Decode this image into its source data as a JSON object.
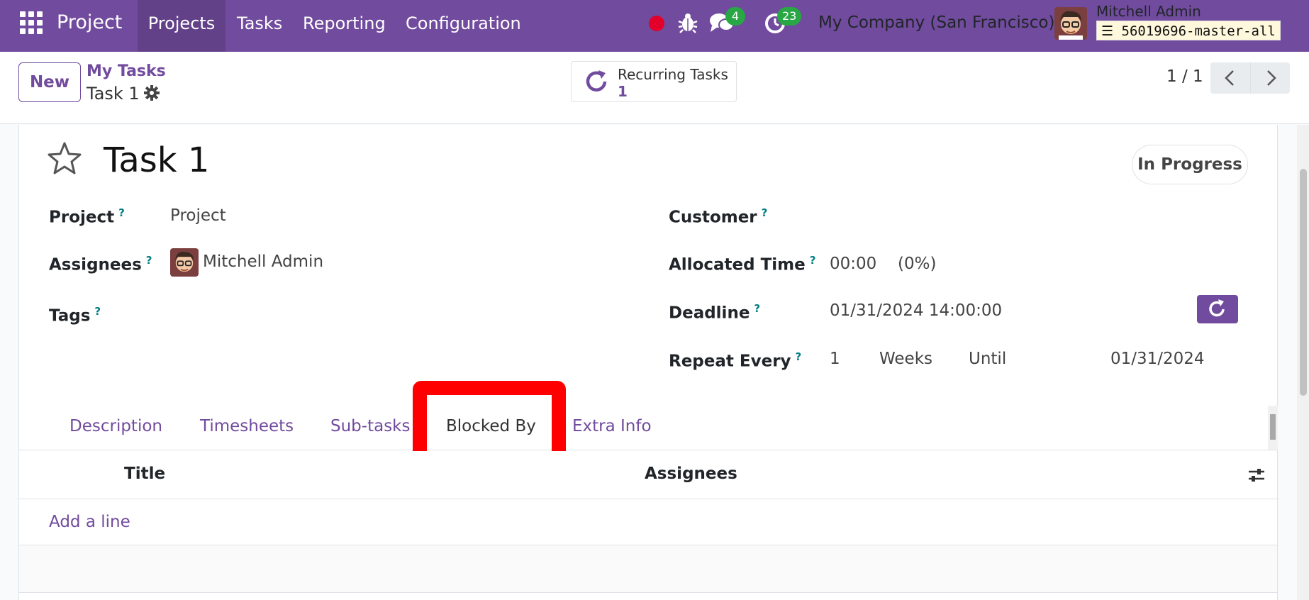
{
  "navbar": {
    "app_name": "Project",
    "menu": [
      "Projects",
      "Tasks",
      "Reporting",
      "Configuration"
    ],
    "chat_count": "4",
    "activity_count": "23",
    "company": "My Company (San Francisco)",
    "user": "Mitchell Admin",
    "database": "56019696-master-all"
  },
  "control_panel": {
    "new_label": "New",
    "breadcrumb_parent": "My Tasks",
    "breadcrumb_current": "Task 1",
    "recurring_label": "Recurring Tasks",
    "recurring_count": "1",
    "pager": "1 / 1"
  },
  "form": {
    "title": "Task 1",
    "stage": "In Progress",
    "help_mark": "?",
    "fields": {
      "project_label": "Project",
      "project_value": "Project",
      "assignees_label": "Assignees",
      "assignee_value": "Mitchell Admin",
      "tags_label": "Tags",
      "customer_label": "Customer",
      "allocated_label": "Allocated Time",
      "allocated_value": "00:00",
      "allocated_percent": "(0%)",
      "deadline_label": "Deadline",
      "deadline_value": "01/31/2024 14:00:00",
      "repeat_label": "Repeat Every",
      "repeat_interval": "1",
      "repeat_unit": "Weeks",
      "repeat_until_label": "Until",
      "repeat_until_date": "01/31/2024"
    },
    "tabs": [
      "Description",
      "Timesheets",
      "Sub-tasks",
      "Blocked By",
      "Extra Info"
    ],
    "active_tab": "Blocked By",
    "list": {
      "columns": [
        "Title",
        "Assignees"
      ],
      "add_line": "Add a line"
    }
  },
  "colors": {
    "brand": "#714b9d",
    "highlight": "#ff0000",
    "badge": "#28a745"
  }
}
